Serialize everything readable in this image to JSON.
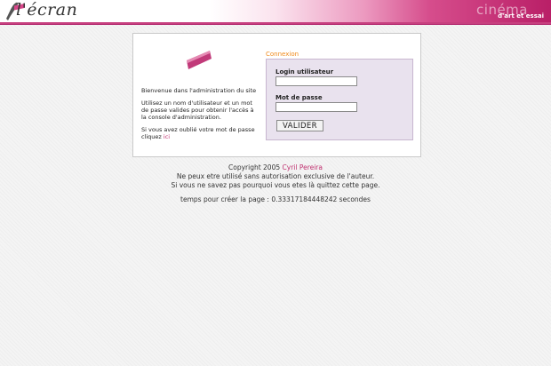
{
  "header": {
    "logo_text": "l'écran",
    "cinema_text": "cinéma",
    "tagline": "d'art et essai",
    "colors": {
      "accent": "#c7407f",
      "brand": "#b91f67"
    }
  },
  "intro": {
    "welcome": "Bienvenue dans l'administration du site",
    "instructions": "Utilisez un nom d'utilisateur et un mot de passe valides pour obtenir l'accès à la console d'administration.",
    "forgot_text": "Si vous avez oublié votre mot de passe cliquez",
    "forgot_link": "ici"
  },
  "login": {
    "title": "Connexion",
    "username_label": "Login utilisateur",
    "username_value": "",
    "password_label": "Mot de passe",
    "password_value": "",
    "submit_label": "VALIDER"
  },
  "footer": {
    "copyright_prefix": "Copyright 2005",
    "author": "Cyril Pereira",
    "line1": "Ne peux etre utilisé sans autorisation exclusive de l'auteur.",
    "line2": "Si vous ne savez pas pourquoi vous etes là quittez cette page.",
    "render_time": "temps pour créer la page : 0.33317184448242 secondes"
  }
}
